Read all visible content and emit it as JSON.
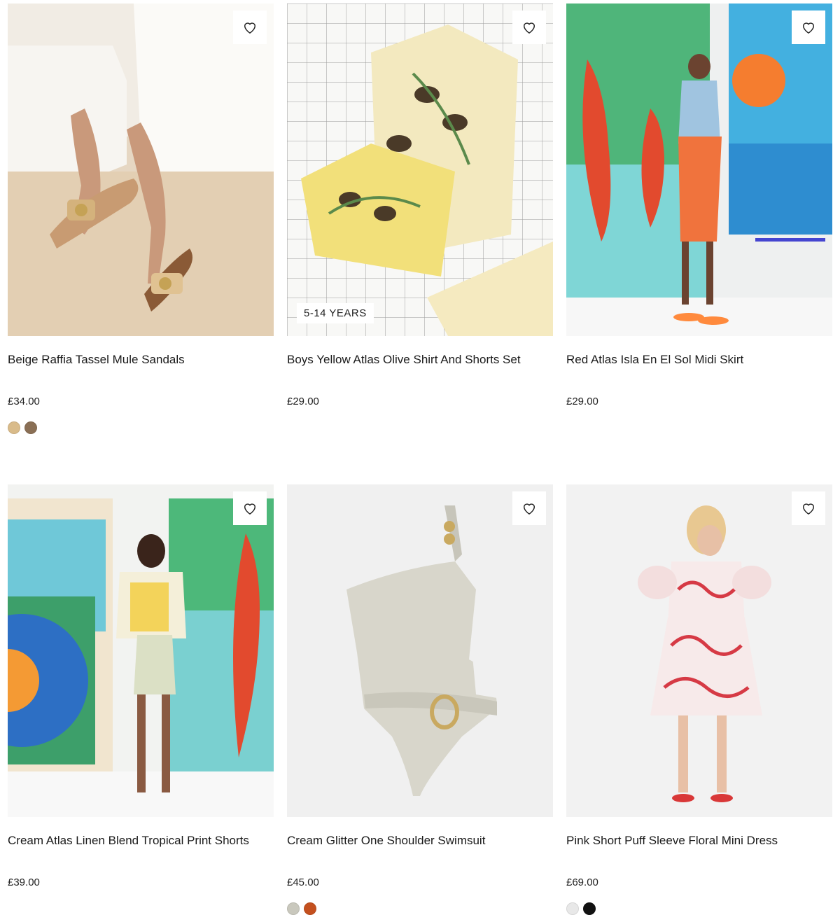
{
  "products": [
    {
      "title": "Beige Raffia Tassel Mule Sandals",
      "price": "£34.00",
      "badge": "",
      "wishlist_icon": "heart-outline-icon",
      "swatches": [
        "#d9bb8a",
        "#8a6f55"
      ]
    },
    {
      "title": "Boys Yellow Atlas Olive Shirt And Shorts Set",
      "price": "£29.00",
      "badge": "5-14 YEARS",
      "wishlist_icon": "heart-outline-icon",
      "swatches": []
    },
    {
      "title": "Red Atlas Isla En El Sol Midi Skirt",
      "price": "£29.00",
      "badge": "",
      "wishlist_icon": "heart-outline-icon",
      "swatches": []
    },
    {
      "title": "Cream Atlas Linen Blend Tropical Print Shorts",
      "price": "£39.00",
      "badge": "",
      "wishlist_icon": "heart-outline-icon",
      "swatches": []
    },
    {
      "title": "Cream Glitter One Shoulder Swimsuit",
      "price": "£45.00",
      "badge": "",
      "wishlist_icon": "heart-outline-icon",
      "swatches": [
        "#c9c8bd",
        "#c4501e"
      ]
    },
    {
      "title": "Pink Short Puff Sleeve Floral Mini Dress",
      "price": "£69.00",
      "badge": "",
      "wishlist_icon": "heart-outline-icon",
      "swatches": [
        "#e8e8e8",
        "#111111"
      ]
    }
  ]
}
